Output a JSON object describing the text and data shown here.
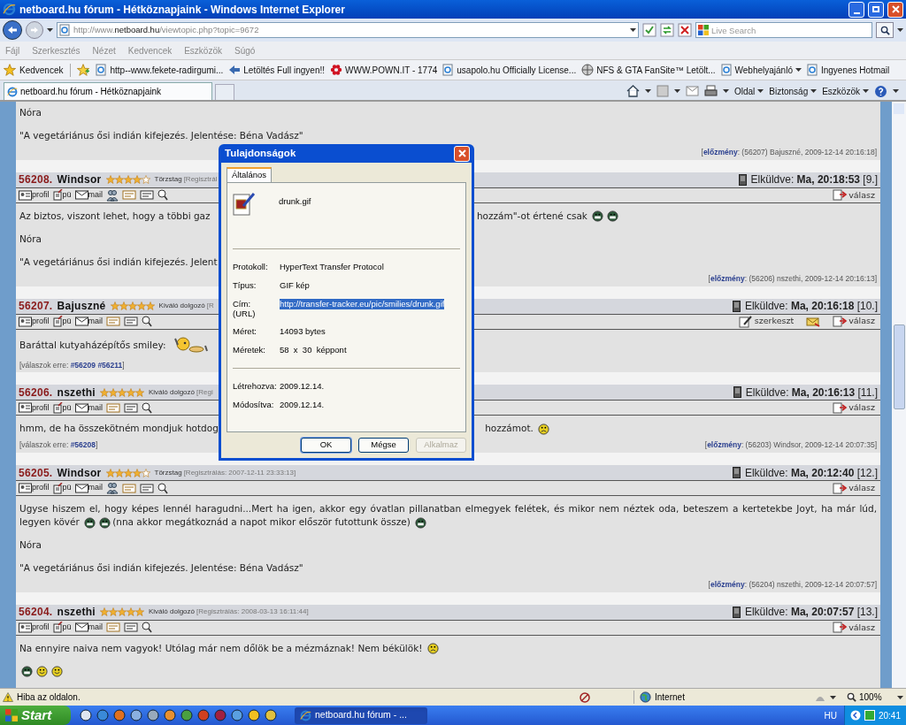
{
  "window": {
    "title": "netboard.hu fórum - Hétköznapjaink - Windows Internet Explorer"
  },
  "address_bar": {
    "url": "http://www.**netboard.hu**/viewtopic.php?topic=9672"
  },
  "search": {
    "placeholder": "Live Search"
  },
  "menu": [
    "Fájl",
    "Szerkesztés",
    "Nézet",
    "Kedvencek",
    "Eszközök",
    "Súgó"
  ],
  "favorites_bar": {
    "label": "Kedvencek",
    "links": [
      {
        "label": "http--www.fekete-radirgumi...",
        "kind": "page",
        "dropdown": false
      },
      {
        "label": "Letöltés Full ingyen!!",
        "kind": "arrow",
        "dropdown": false
      },
      {
        "label": "WWW.POWN.IT - 1774",
        "kind": "flower",
        "dropdown": false
      },
      {
        "label": "usapolo.hu Officially License...",
        "kind": "page",
        "dropdown": false
      },
      {
        "label": "NFS & GTA FanSite™ Letölt...",
        "kind": "globe",
        "dropdown": false
      },
      {
        "label": "Webhelyajánló",
        "kind": "page",
        "dropdown": true
      },
      {
        "label": "Ingyenes Hotmail",
        "kind": "page",
        "dropdown": false
      }
    ]
  },
  "tabs": [
    {
      "label": "netboard.hu fórum - Hétköznapjaink",
      "selected": true
    }
  ],
  "command_bar": [
    "Oldal",
    "Biztonság",
    "Eszközök"
  ],
  "posts": [
    {
      "kind": "tail",
      "paragraphs": [
        [
          {
            "kind": "text",
            "text": "Nóra"
          }
        ],
        [
          {
            "kind": "text",
            "text": "\"A vegetáriánus ősi indián kifejezés. Jelentése: Béna Vadász\""
          }
        ]
      ],
      "footer_right": "[**előzmény**: (56207) Bajuszné, 2009-12-14 20:16:18]"
    },
    {
      "kind": "post",
      "number": "56208.",
      "author": "Windsor",
      "stars": 4,
      "rank": "Törzstag",
      "registration": "[Regisztrál",
      "sent": "Elküldve: **Ma, 20:18:53** [9.]",
      "links": [
        "profil",
        "pü",
        "mail"
      ],
      "buddy": true,
      "actions": [
        {
          "kind": "reply",
          "label": "válasz"
        }
      ],
      "paragraphs": [
        [
          {
            "kind": "text",
            "text": "Az biztos, viszont lehet, hogy a többi gaz"
          },
          {
            "kind": "gap"
          },
          {
            "kind": "text",
            "text": "hozzám\"-ot értené csak"
          },
          {
            "kind": "grin"
          },
          {
            "kind": "grin"
          }
        ],
        [
          {
            "kind": "text",
            "text": "Nóra"
          }
        ],
        [
          {
            "kind": "text",
            "text": "\"A vegetáriánus ősi indián kifejezés. Jelent"
          }
        ]
      ],
      "footer_right": "[**előzmény**: (56206) nszethi, 2009-12-14 20:16:13]"
    },
    {
      "kind": "post",
      "number": "56207.",
      "author": "Bajuszné",
      "stars": 5,
      "rank": "Kiváló dolgozó",
      "registration": "[R",
      "sent": "Elküldve: **Ma, 20:16:18** [10.]",
      "links": [
        "profil",
        "pü",
        "mail"
      ],
      "buddy": false,
      "actions": [
        {
          "kind": "edit",
          "label": "szerkeszt"
        },
        {
          "kind": "mailbox"
        },
        {
          "kind": "reply",
          "label": "válasz"
        }
      ],
      "paragraphs": [
        [
          {
            "kind": "text",
            "text": "Baráttal kutyaházépítős smiley:"
          },
          {
            "kind": "builder"
          }
        ]
      ],
      "footer_left": "[válaszok erre: **#56209** **#56211**]"
    },
    {
      "kind": "post",
      "number": "56206.",
      "author": "nszethi",
      "stars": 5,
      "rank": "Kiváló dolgozó",
      "registration": "[Regi",
      "sent": "Elküldve: **Ma, 20:16:13** [11.]",
      "links": [
        "profil",
        "pü",
        "mail"
      ],
      "buddy": false,
      "actions": [
        {
          "kind": "reply",
          "label": "válasz"
        }
      ],
      "paragraphs": [
        [
          {
            "kind": "text",
            "text": "hmm, de ha összekötném mondjuk hotdog"
          },
          {
            "kind": "gap"
          },
          {
            "kind": "text",
            "text": "hozzámot."
          },
          {
            "kind": "sad"
          }
        ]
      ],
      "footer_left": "[válaszok erre: **#56208**]",
      "footer_right": "[**előzmény**: (56203) Windsor, 2009-12-14 20:07:35]"
    },
    {
      "kind": "post",
      "number": "56205.",
      "author": "Windsor",
      "stars": 4,
      "rank": "Törzstag",
      "registration": "[Regisztrálás: 2007-12-11 23:33:13]",
      "sent": "Elküldve: **Ma, 20:12:40** [12.]",
      "links": [
        "profil",
        "pü",
        "mail"
      ],
      "buddy": true,
      "actions": [
        {
          "kind": "reply",
          "label": "válasz"
        }
      ],
      "paragraphs": [
        [
          {
            "kind": "line",
            "text": "Ugyse hiszem el, hogy képes lennél haragudni...Mert ha igen, akkor egy óvatlan pillanatban elmegyek felétek, és mikor nem néztek oda, beteszem a kertetekbe Joyt, ha már lúd,"
          },
          {
            "kind": "text",
            "text": "legyen kövér"
          },
          {
            "kind": "grin"
          },
          {
            "kind": "grin"
          },
          {
            "kind": "text",
            "text": "(nna akkor megátkoznád a napot mikor először futottunk össze)"
          },
          {
            "kind": "grin"
          }
        ],
        [
          {
            "kind": "text",
            "text": "Nóra"
          }
        ],
        [
          {
            "kind": "text",
            "text": "\"A vegetáriánus ősi indián kifejezés. Jelentése: Béna Vadász\""
          }
        ]
      ],
      "footer_right": "[**előzmény**: (56204) nszethi, 2009-12-14 20:07:57]"
    },
    {
      "kind": "post",
      "number": "56204.",
      "author": "nszethi",
      "stars": 5,
      "rank": "Kiváló dolgozó",
      "registration": "[Regisztrálás: 2008-03-13 16:11:44]",
      "sent": "Elküldve: **Ma, 20:07:57** [13.]",
      "links": [
        "profil",
        "pü",
        "mail"
      ],
      "buddy": false,
      "actions": [
        {
          "kind": "reply",
          "label": "válasz"
        }
      ],
      "paragraphs": [
        [
          {
            "kind": "text",
            "text": "Na ennyire naiva nem vagyok! Utólag már nem dőlök be a mézmáznak! Nem békülök!"
          },
          {
            "kind": "sad"
          }
        ],
        [
          {
            "kind": "grin"
          },
          {
            "kind": "smile"
          },
          {
            "kind": "smile"
          }
        ]
      ]
    }
  ],
  "dialog": {
    "title": "Tulajdonságok",
    "tabs": [
      {
        "label": "Általános",
        "selected": true
      }
    ],
    "file_name": "drunk.gif",
    "property_groups": [
      [
        {
          "label": "Protokoll:",
          "value": "HyperText Transfer Protocol",
          "selected": false
        },
        {
          "label": "Típus:",
          "value": "GIF kép",
          "selected": false
        },
        {
          "label": "Cím:",
          "sublabel": "(URL)",
          "value": "http://transfer-tracker.eu/pic/smilies/drunk.gif",
          "selected": true
        },
        {
          "label": "Méret:",
          "value": "14093 bytes",
          "selected": false
        },
        {
          "label": "Méretek:",
          "value": "58  x  30  képpont",
          "selected": false
        }
      ],
      [
        {
          "label": "Létrehozva:",
          "value": "2009.12.14.",
          "selected": false
        },
        {
          "label": "Módosítva:",
          "value": "2009.12.14.",
          "selected": false
        }
      ]
    ],
    "buttons": [
      {
        "label": "OK",
        "default": true,
        "disabled": false
      },
      {
        "label": "Mégse",
        "default": false,
        "disabled": false
      },
      {
        "label": "Alkalmaz",
        "default": false,
        "disabled": true
      }
    ]
  },
  "status_bar": {
    "message": "Hiba az oldalon.",
    "zone": "Internet",
    "zoom": "100%"
  },
  "taskbar": {
    "start": "Start",
    "tasks": [
      {
        "label": "netboard.hu fórum - ...",
        "selected": true
      }
    ],
    "language": "HU",
    "clock": "20:41"
  }
}
